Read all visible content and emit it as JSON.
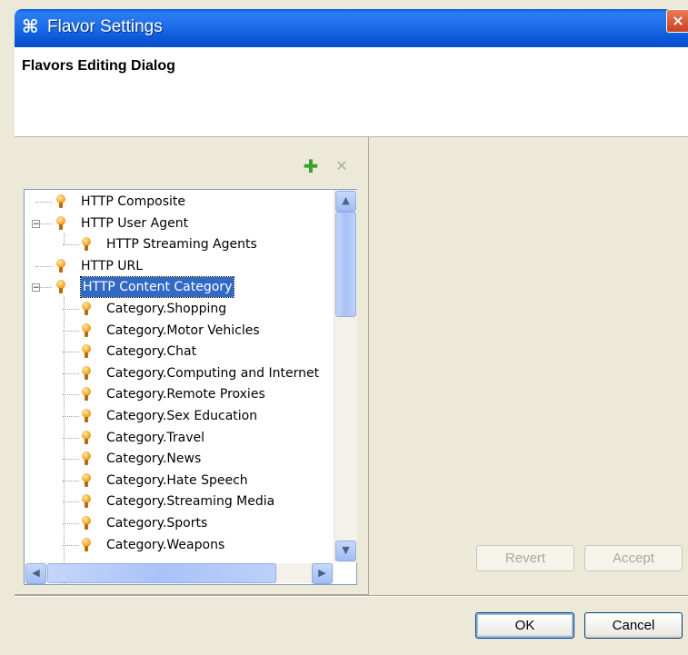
{
  "window": {
    "title": "Flavor Settings",
    "close": "×",
    "icon": "⌘"
  },
  "header": {
    "title": "Flavors Editing Dialog"
  },
  "toolbar": {
    "add_icon": "✚",
    "remove_icon": "✕"
  },
  "tree": {
    "items": [
      {
        "label": "HTTP Composite",
        "level": 0,
        "expander": ""
      },
      {
        "label": "HTTP User Agent",
        "level": 0,
        "expander": "−"
      },
      {
        "label": "HTTP Streaming Agents",
        "level": 1,
        "expander": ""
      },
      {
        "label": "HTTP URL",
        "level": 0,
        "expander": ""
      },
      {
        "label": "HTTP Content Category",
        "level": 0,
        "expander": "−",
        "selected": true
      },
      {
        "label": "Category.Shopping",
        "level": 1,
        "expander": ""
      },
      {
        "label": "Category.Motor Vehicles",
        "level": 1,
        "expander": ""
      },
      {
        "label": "Category.Chat",
        "level": 1,
        "expander": ""
      },
      {
        "label": "Category.Computing and Internet",
        "level": 1,
        "expander": ""
      },
      {
        "label": "Category.Remote Proxies",
        "level": 1,
        "expander": ""
      },
      {
        "label": "Category.Sex Education",
        "level": 1,
        "expander": ""
      },
      {
        "label": "Category.Travel",
        "level": 1,
        "expander": ""
      },
      {
        "label": "Category.News",
        "level": 1,
        "expander": ""
      },
      {
        "label": "Category.Hate Speech",
        "level": 1,
        "expander": ""
      },
      {
        "label": "Category.Streaming Media",
        "level": 1,
        "expander": ""
      },
      {
        "label": "Category.Sports",
        "level": 1,
        "expander": ""
      },
      {
        "label": "Category.Weapons",
        "level": 1,
        "expander": ""
      }
    ]
  },
  "scrollbars": {
    "up": "▲",
    "down": "▼",
    "left": "◀",
    "right": "▶"
  },
  "buttons": {
    "revert": "Revert",
    "accept": "Accept",
    "ok": "OK",
    "cancel": "Cancel"
  }
}
